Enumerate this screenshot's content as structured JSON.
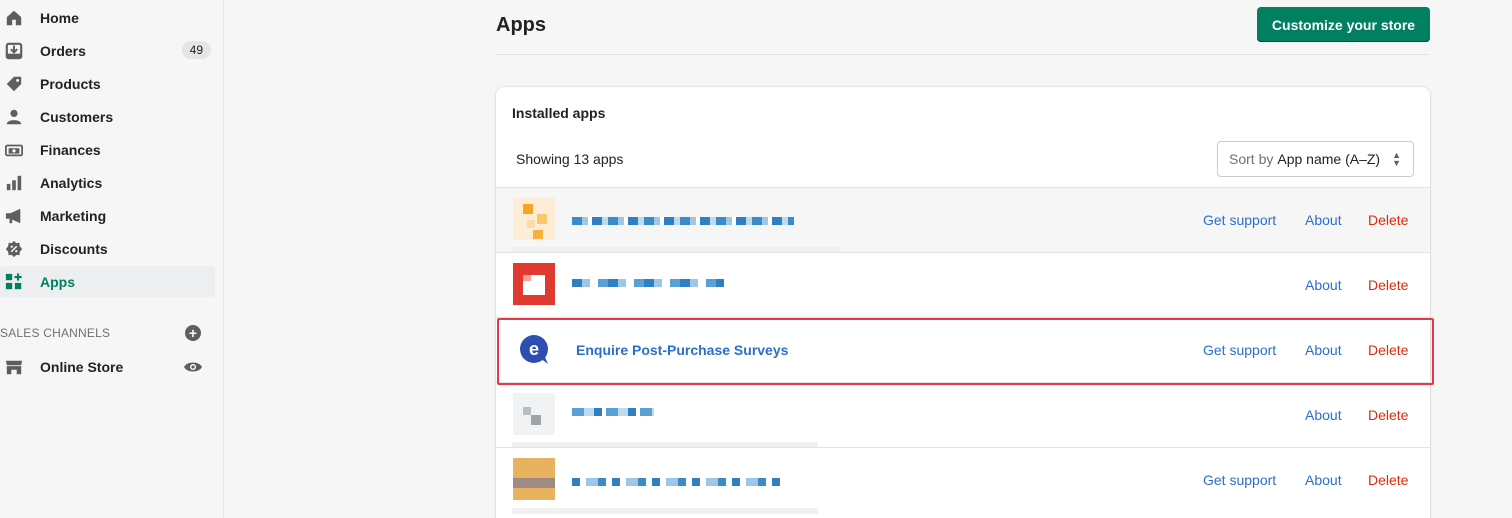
{
  "sidebar": {
    "items": [
      {
        "label": "Home",
        "icon": "home-icon"
      },
      {
        "label": "Orders",
        "icon": "orders-icon",
        "badge": "49"
      },
      {
        "label": "Products",
        "icon": "tag-icon"
      },
      {
        "label": "Customers",
        "icon": "person-icon"
      },
      {
        "label": "Finances",
        "icon": "finances-icon"
      },
      {
        "label": "Analytics",
        "icon": "bar-chart-icon"
      },
      {
        "label": "Marketing",
        "icon": "megaphone-icon"
      },
      {
        "label": "Discounts",
        "icon": "discount-icon"
      },
      {
        "label": "Apps",
        "icon": "apps-icon",
        "active": true
      }
    ],
    "sales_channels_title": "SALES CHANNELS",
    "online_store_label": "Online Store"
  },
  "header": {
    "title": "Apps",
    "customize_button": "Customize your store"
  },
  "card": {
    "title": "Installed apps",
    "showing": "Showing 13 apps",
    "sort_prefix": "Sort by",
    "sort_value": "App name (A–Z)"
  },
  "apps": [
    {
      "name": "",
      "support": "Get support",
      "about": "About",
      "delete": "Delete"
    },
    {
      "name": "",
      "about": "About",
      "delete": "Delete"
    },
    {
      "name": "Enquire Post-Purchase Surveys",
      "support": "Get support",
      "about": "About",
      "delete": "Delete"
    },
    {
      "name": "",
      "about": "About",
      "delete": "Delete"
    },
    {
      "name": "",
      "support": "Get support",
      "about": "About",
      "delete": "Delete"
    }
  ],
  "colors": {
    "accent": "#008060",
    "link": "#2c6ecb",
    "critical": "#d72c0d",
    "highlight": "#e8374a"
  }
}
